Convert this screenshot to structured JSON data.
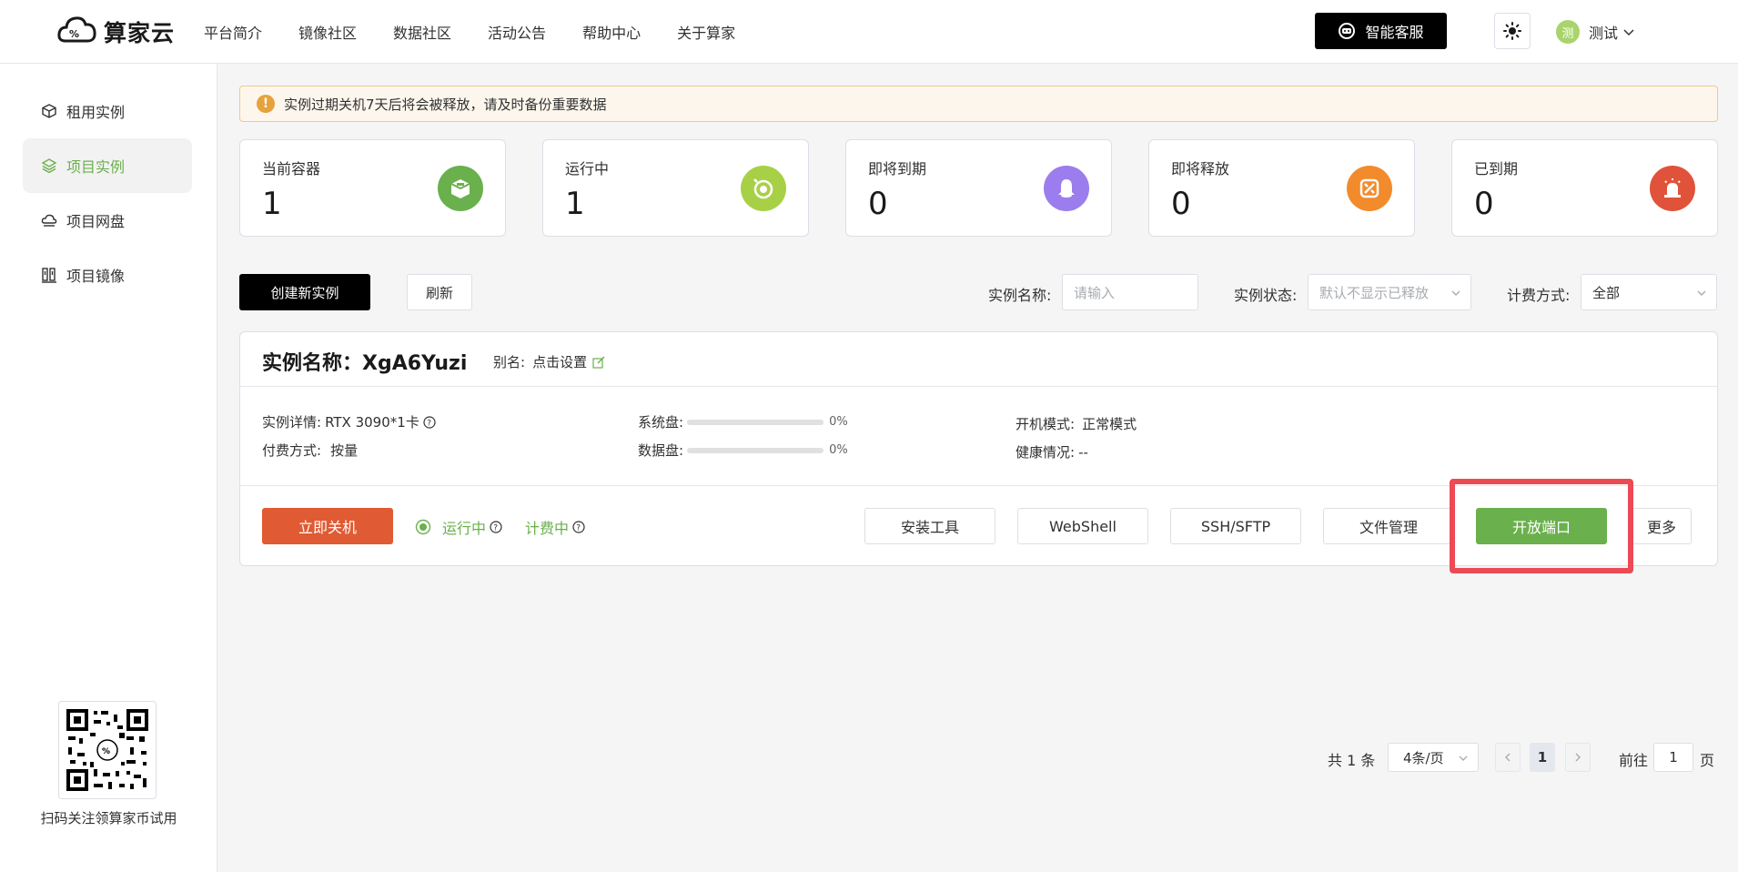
{
  "header": {
    "logo_text": "算家云",
    "nav": [
      "平台简介",
      "镜像社区",
      "数据社区",
      "活动公告",
      "帮助中心",
      "关于算家"
    ],
    "service_label": "智能客服",
    "user_avatar": "测",
    "user_name": "测试"
  },
  "sidebar": {
    "items": [
      {
        "label": "租用实例",
        "icon": "cube-icon"
      },
      {
        "label": "项目实例",
        "icon": "layers-icon"
      },
      {
        "label": "项目网盘",
        "icon": "cloud-drive-icon"
      },
      {
        "label": "项目镜像",
        "icon": "image-icon"
      }
    ],
    "qr_caption": "扫码关注领算家币试用"
  },
  "alert": {
    "text": "实例过期关机7天后将会被释放，请及时备份重要数据"
  },
  "stats": [
    {
      "label": "当前容器",
      "value": "1",
      "color": "#6ab04c",
      "icon": "container-icon"
    },
    {
      "label": "运行中",
      "value": "1",
      "color": "#a8d046",
      "icon": "timer-icon"
    },
    {
      "label": "即将到期",
      "value": "0",
      "color": "#9b7ded",
      "icon": "bell-icon"
    },
    {
      "label": "即将释放",
      "value": "0",
      "color": "#f28b2c",
      "icon": "release-icon"
    },
    {
      "label": "已到期",
      "value": "0",
      "color": "#e0533a",
      "icon": "alarm-icon"
    }
  ],
  "toolbar": {
    "create_label": "创建新实例",
    "refresh_label": "刷新",
    "name_label": "实例名称:",
    "name_placeholder": "请输入",
    "status_label": "实例状态:",
    "status_placeholder": "默认不显示已释放",
    "billing_label": "计费方式:",
    "billing_value": "全部"
  },
  "instance": {
    "title": "实例名称：XgA6Yuzi",
    "alias_label": "别名:",
    "alias_value": "点击设置",
    "detail_label": "实例详情:",
    "detail_value": "RTX 3090*1卡",
    "pay_label": "付费方式:",
    "pay_value": "按量",
    "sys_disk_label": "系统盘:",
    "sys_disk_pct": "0%",
    "data_disk_label": "数据盘:",
    "data_disk_pct": "0%",
    "boot_label": "开机模式:",
    "boot_value": "正常模式",
    "health_label": "健康情况:",
    "health_value": "--",
    "shutdown_label": "立即关机",
    "status_running": "运行中",
    "status_billing": "计费中",
    "actions": [
      "安装工具",
      "WebShell",
      "SSH/SFTP",
      "文件管理",
      "开放端口",
      "更多"
    ]
  },
  "pagination": {
    "total": "共 1 条",
    "page_size": "4条/页",
    "current_page": "1",
    "goto_label": "前往",
    "goto_value": "1",
    "page_suffix": "页"
  },
  "colors": {
    "accent": "#6ab04c",
    "danger": "#e05a33",
    "highlight": "#ec4a55"
  }
}
